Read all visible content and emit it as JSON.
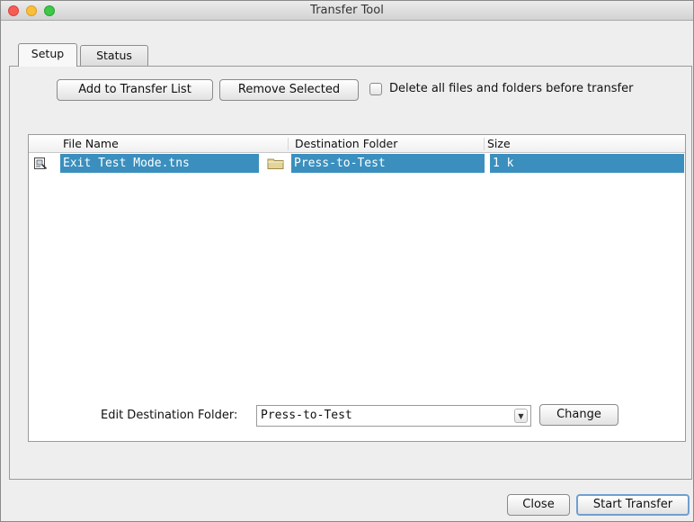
{
  "window": {
    "title": "Transfer Tool"
  },
  "tabs": [
    {
      "label": "Setup",
      "selected": true
    },
    {
      "label": "Status",
      "selected": false
    }
  ],
  "toolbar": {
    "add_label": "Add to Transfer List",
    "remove_label": "Remove Selected",
    "delete_all_label": "Delete all files and folders before transfer",
    "delete_all_checked": false
  },
  "table": {
    "columns": [
      "File Name",
      "Destination Folder",
      "Size"
    ],
    "rows": [
      {
        "file_icon": "document-icon",
        "file_name": "Exit Test Mode.tns",
        "folder_icon": "folder-icon",
        "destination": "Press-to-Test",
        "size": "1 k",
        "selected": true
      }
    ]
  },
  "destination": {
    "label": "Edit Destination Folder:",
    "value": "Press-to-Test",
    "change_label": "Change"
  },
  "footer": {
    "close_label": "Close",
    "start_label": "Start Transfer"
  },
  "colors": {
    "selection": "#3a8fbe",
    "close": "#f45c55",
    "minimize": "#f9be3b",
    "maximize": "#3ec748"
  }
}
